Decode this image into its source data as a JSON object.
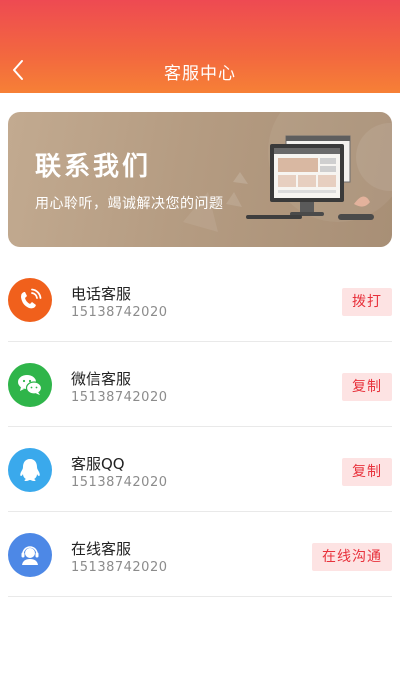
{
  "header": {
    "title": "客服中心",
    "back_icon": "chevron-left-icon"
  },
  "banner": {
    "title": "联系我们",
    "subtitle": "用心聆听，竭诚解决您的问题"
  },
  "colors": {
    "accent": "#e8323c",
    "phone": "#f0601c",
    "wechat": "#2fb54a",
    "qq": "#3aa9ec",
    "online": "#4d88e6"
  },
  "contacts": [
    {
      "name": "电话客服",
      "number": "15138742020",
      "action": "拨打",
      "icon": "phone-icon"
    },
    {
      "name": "微信客服",
      "number": "15138742020",
      "action": "复制",
      "icon": "wechat-icon"
    },
    {
      "name": "客服QQ",
      "number": "15138742020",
      "action": "复制",
      "icon": "qq-icon"
    },
    {
      "name": "在线客服",
      "number": "15138742020",
      "action": "在线沟通",
      "icon": "headset-icon"
    }
  ]
}
